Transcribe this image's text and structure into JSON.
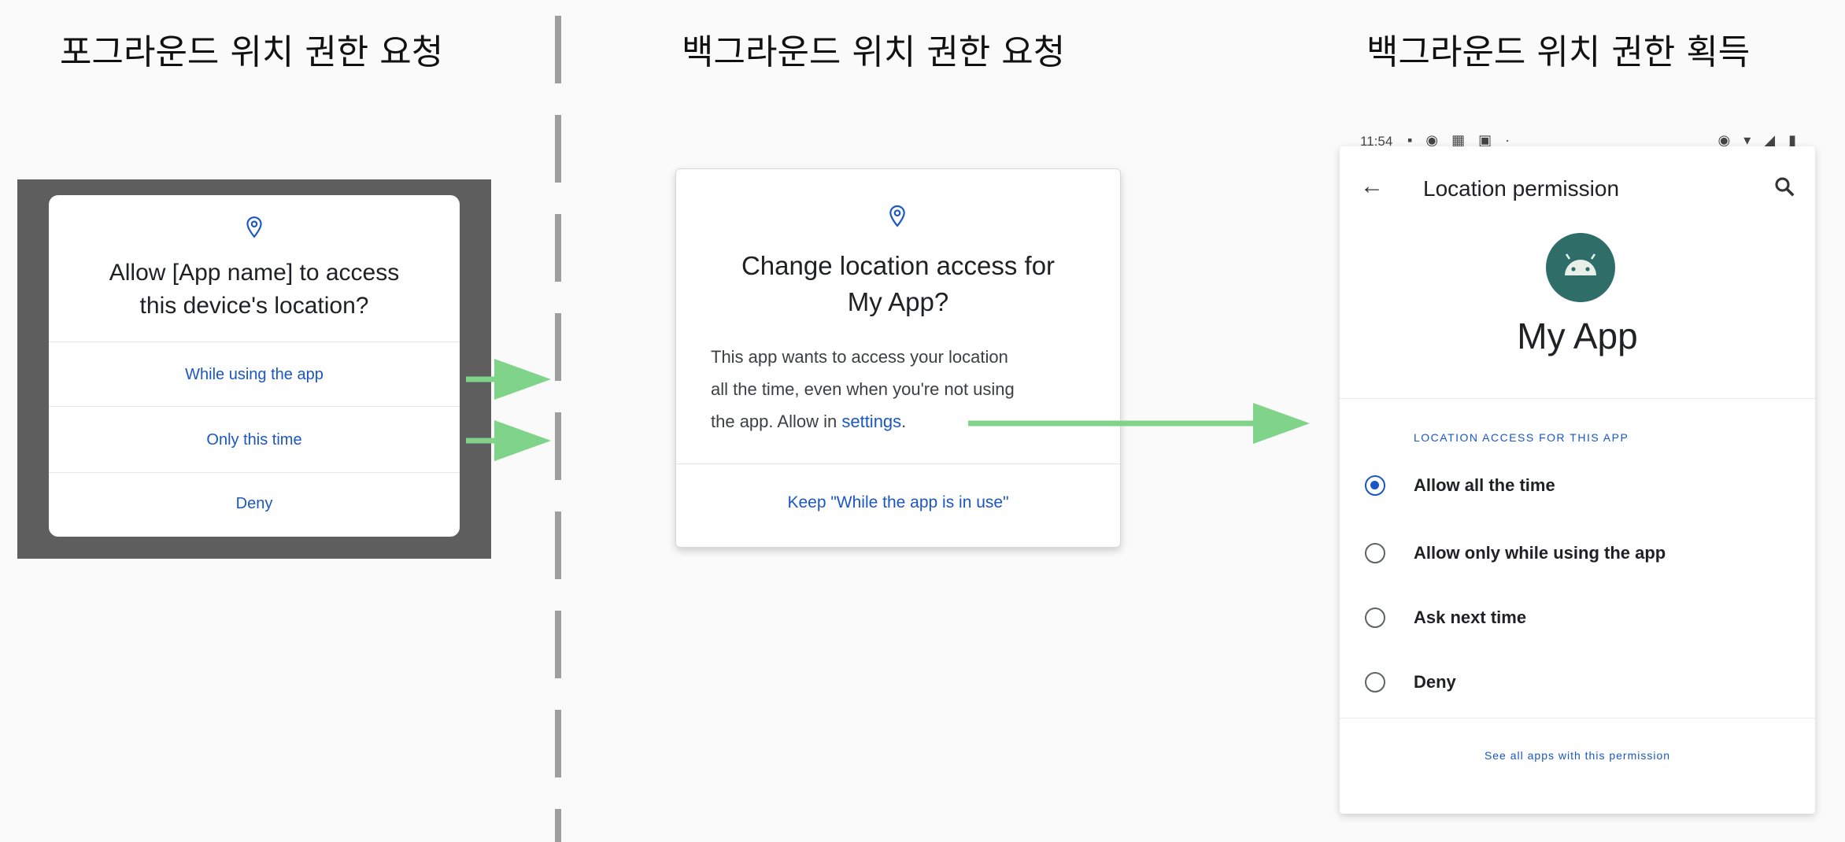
{
  "headings": {
    "foreground": "포그라운드 위치 권한 요청",
    "background_request": "백그라운드 위치 권한 요청",
    "background_granted": "백그라운드 위치 권한 획득"
  },
  "foreground_dialog": {
    "icon": "location-pin-icon",
    "title_line1": "Allow [App name] to access",
    "title_line2": "this device's location?",
    "options": [
      "While using the app",
      "Only this time",
      "Deny"
    ]
  },
  "background_dialog": {
    "icon": "location-pin-icon",
    "title_line1": "Change location access for",
    "title_line2": "My App?",
    "body_line1": "This app wants to access your location",
    "body_line2": "all the time, even when you're not using",
    "body_line3_prefix": "the app. Allow in ",
    "body_link": "settings",
    "body_line3_suffix": ".",
    "keep_button": "Keep \"While the app is in use\""
  },
  "settings_screen": {
    "status_time": "11:54",
    "top_title": "Location permission",
    "app_name": "My App",
    "section_label": "LOCATION ACCESS FOR THIS APP",
    "options": [
      {
        "label": "Allow all the time",
        "selected": true
      },
      {
        "label": "Allow only while using the app",
        "selected": false
      },
      {
        "label": "Ask next time",
        "selected": false
      },
      {
        "label": "Deny",
        "selected": false
      }
    ],
    "see_all": "See all apps with this permission"
  },
  "colors": {
    "arrow": "#7fd48a",
    "link": "#1a56c4",
    "dim_frame": "#5e5e5e",
    "avatar": "#2f6e68"
  }
}
